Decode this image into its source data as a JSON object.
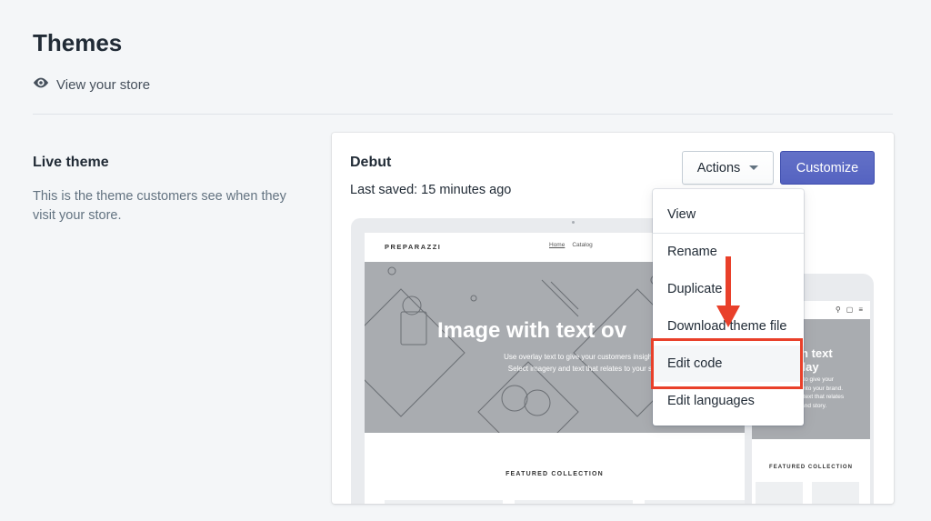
{
  "page": {
    "title": "Themes",
    "view_store": "View your store"
  },
  "live_theme": {
    "heading": "Live theme",
    "description": "This is the theme customers see when they visit your store."
  },
  "theme_card": {
    "name": "Debut",
    "last_saved": "Last saved: 15 minutes ago",
    "actions_label": "Actions",
    "customize_label": "Customize"
  },
  "preview": {
    "store_name": "PREPARAZZI",
    "nav": [
      "Home",
      "Catalog"
    ],
    "hero_title": "Image with text ov",
    "hero_sub_1": "Use overlay text to give your customers insight in",
    "hero_sub_2": "Select imagery and text that relates to your sty",
    "featured": "FEATURED COLLECTION",
    "mobile_hero_title": "with text\nverlay",
    "mobile_hero_sub": "text to give your\nght into your brand.\nand text that relates\nyle and story.",
    "mobile_featured": "FEATURED COLLECTION"
  },
  "dropdown": {
    "items": [
      "View",
      "Rename",
      "Duplicate",
      "Download theme file",
      "Edit code",
      "Edit languages"
    ]
  },
  "colors": {
    "accent": "#5c6ac4",
    "highlight": "#e9402a",
    "background": "#f4f6f8"
  }
}
